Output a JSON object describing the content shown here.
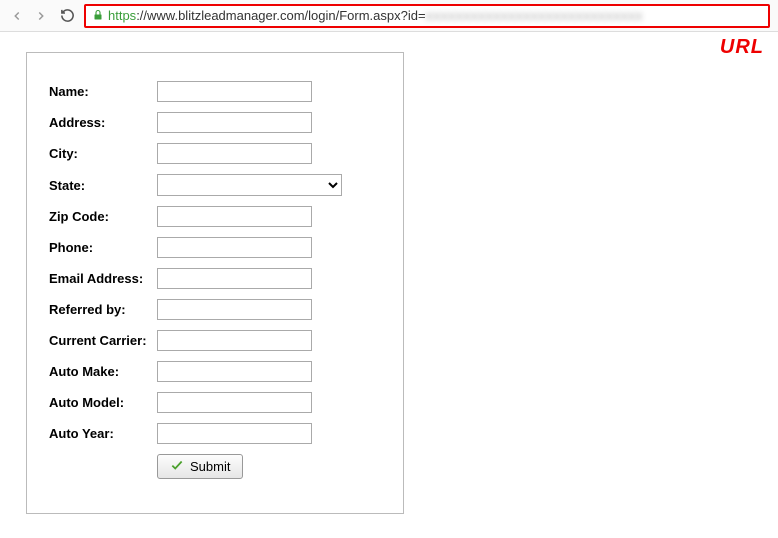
{
  "browser": {
    "url_scheme": "https",
    "url_rest": "://www.blitzleadmanager.com/login/Form.aspx?id="
  },
  "annotation": {
    "url_label": "URL"
  },
  "form": {
    "fields": [
      {
        "label": "Name:"
      },
      {
        "label": "Address:"
      },
      {
        "label": "City:"
      },
      {
        "label": "State:"
      },
      {
        "label": "Zip Code:"
      },
      {
        "label": "Phone:"
      },
      {
        "label": "Email Address:"
      },
      {
        "label": "Referred by:"
      },
      {
        "label": "Current Carrier:"
      },
      {
        "label": "Auto Make:"
      },
      {
        "label": "Auto Model:"
      },
      {
        "label": "Auto Year:"
      }
    ],
    "submit_label": "Submit"
  }
}
